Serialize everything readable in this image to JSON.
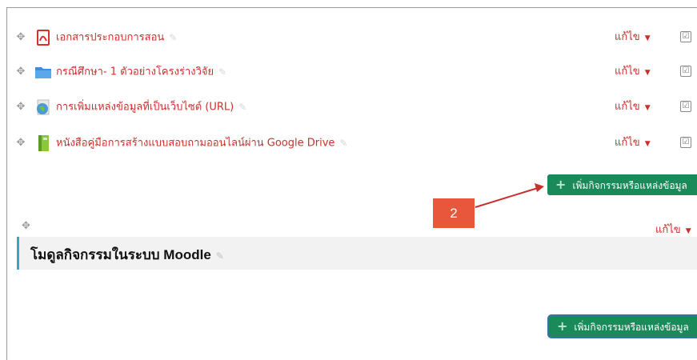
{
  "activities": [
    {
      "icon": "pdf-icon",
      "label": "เอกสารประกอบการสอน",
      "edit": "แก้ไข",
      "check": "☑"
    },
    {
      "icon": "folder-icon",
      "label": "กรณีศึกษา- 1 ตัวอย่างโครงร่างวิจัย",
      "edit": "แก้ไข",
      "check": "☑"
    },
    {
      "icon": "globe-url-icon",
      "label": "การเพิ่มแหล่งข้อมูลที่เป็นเว็บไซต์ (URL)",
      "edit": "แก้ไข",
      "check": "☑"
    },
    {
      "icon": "book-icon",
      "label": "หนังสือคู่มือการสร้างแบบสอบถามออนไลน์ผ่าน Google Drive",
      "edit": "แก้ไข",
      "check": "☑"
    }
  ],
  "add_activity_label": "เพิ่มกิจกรรมหรือแหล่งข้อมูล",
  "annotation_number": "2",
  "section": {
    "title": "โมดูลกิจกรรมในระบบ Moodle",
    "edit": "แก้ไข"
  },
  "colors": {
    "link": "#c9302c",
    "button": "#1b8a5a",
    "section_border": "#2ea7d5",
    "badge": "#e8563b"
  }
}
